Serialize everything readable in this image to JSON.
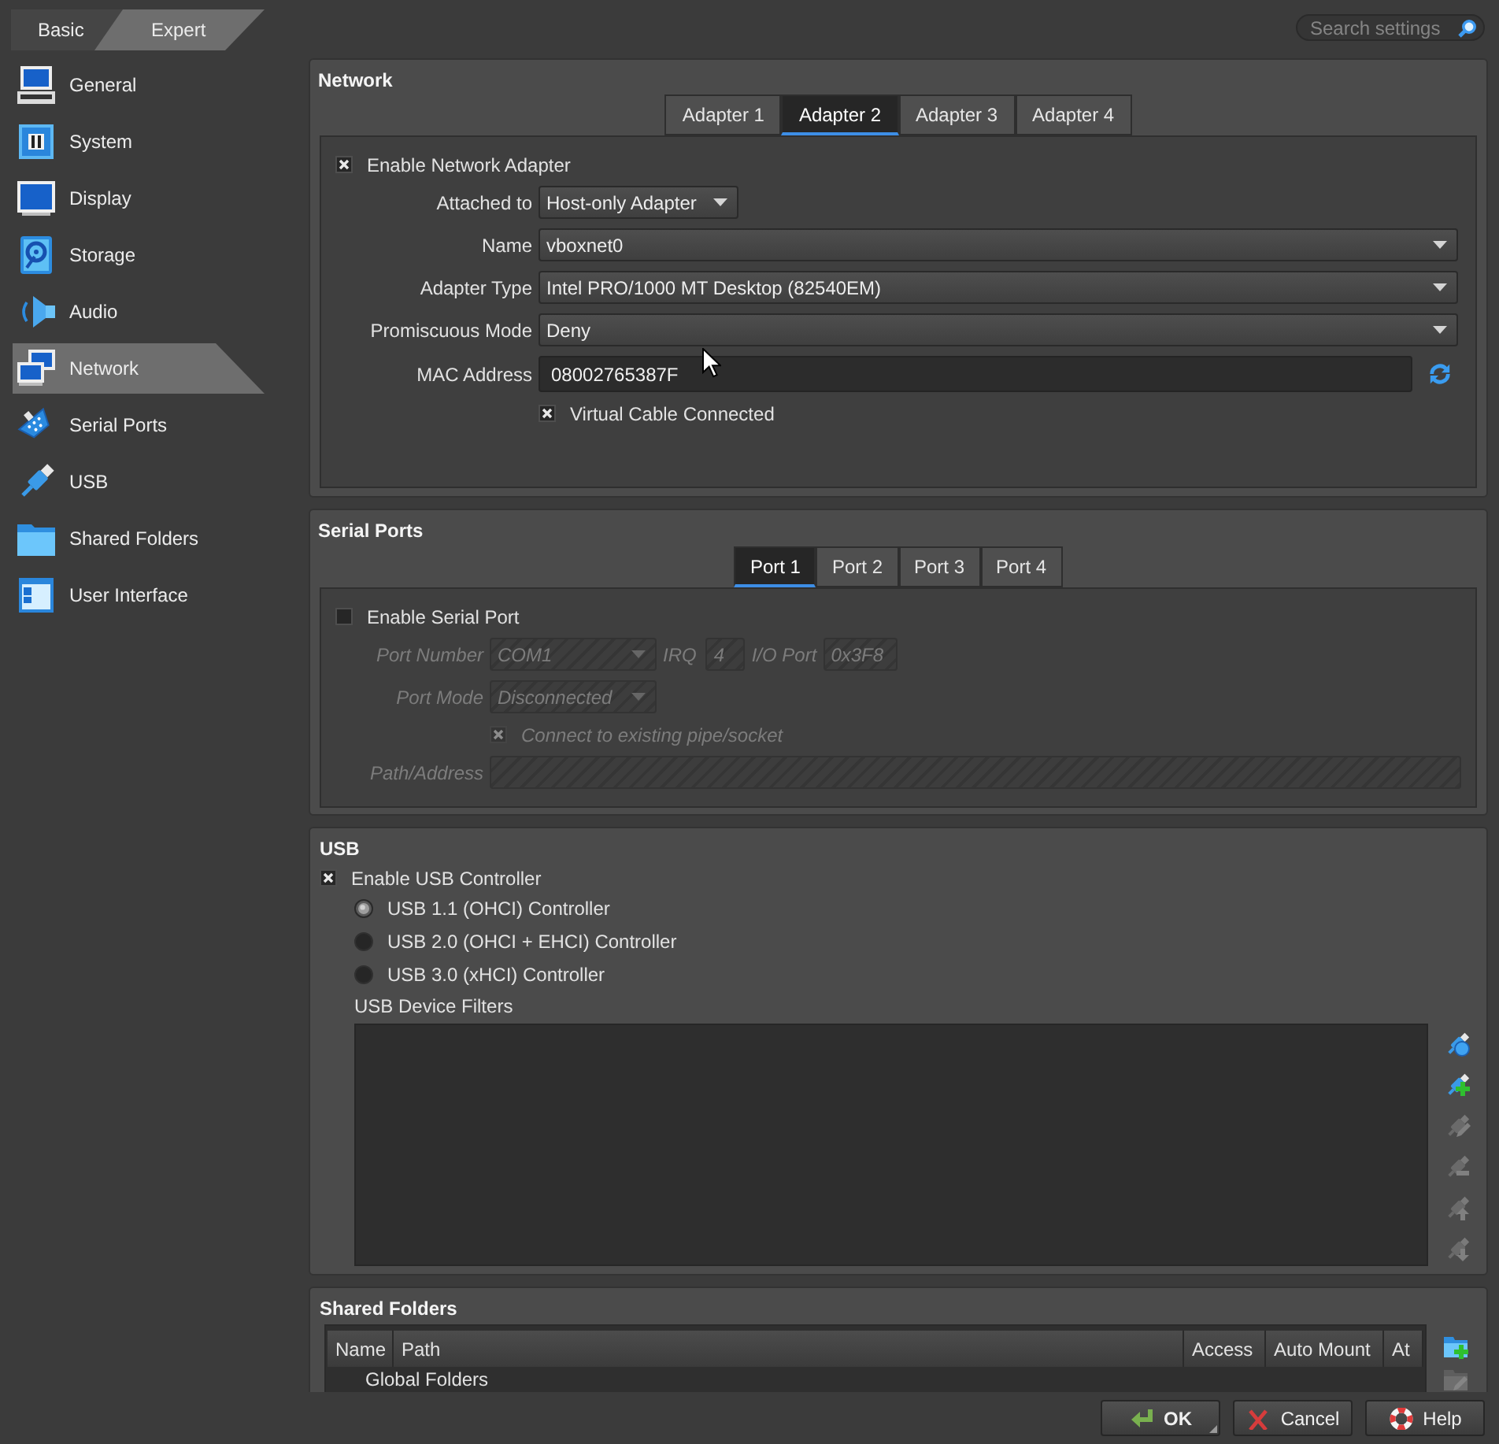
{
  "mode_toggle": [
    {
      "label": "Basic",
      "selected": false
    },
    {
      "label": "Expert",
      "selected": true
    }
  ],
  "search": {
    "placeholder": "Search settings"
  },
  "sidebar": {
    "items": [
      {
        "label": "General",
        "kind": "general",
        "selected": false
      },
      {
        "label": "System",
        "kind": "system",
        "selected": false
      },
      {
        "label": "Display",
        "kind": "display",
        "selected": false
      },
      {
        "label": "Storage",
        "kind": "storage",
        "selected": false
      },
      {
        "label": "Audio",
        "kind": "audio",
        "selected": false
      },
      {
        "label": "Network",
        "kind": "network",
        "selected": true
      },
      {
        "label": "Serial Ports",
        "kind": "serial",
        "selected": false
      },
      {
        "label": "USB",
        "kind": "usb",
        "selected": false
      },
      {
        "label": "Shared Folders",
        "kind": "folders",
        "selected": false
      },
      {
        "label": "User Interface",
        "kind": "interface",
        "selected": false
      }
    ]
  },
  "network": {
    "title": "Network",
    "tabs": [
      {
        "label": "Adapter 1",
        "selected": false
      },
      {
        "label": "Adapter 2",
        "selected": true
      },
      {
        "label": "Adapter 3",
        "selected": false
      },
      {
        "label": "Adapter 4",
        "selected": false
      }
    ],
    "enable": {
      "label": "Enable Network Adapter",
      "checked": true
    },
    "fields": [
      {
        "kind": "compact",
        "label": "Attached to",
        "value": "Host-only Adapter"
      },
      {
        "kind": "combo",
        "label": "Name",
        "value": "vboxnet0"
      },
      {
        "kind": "combo",
        "label": "Adapter Type",
        "value": "Intel PRO/1000 MT Desktop (82540EM)"
      },
      {
        "kind": "combo",
        "label": "Promiscuous Mode",
        "value": "Deny"
      },
      {
        "kind": "text",
        "label": "MAC Address",
        "value": "08002765387F"
      }
    ],
    "cable": {
      "label": "Virtual Cable Connected",
      "checked": true
    }
  },
  "serial_ports": {
    "title": "Serial Ports",
    "tabs": [
      {
        "label": "Port 1",
        "selected": true
      },
      {
        "label": "Port 2",
        "selected": false
      },
      {
        "label": "Port 3",
        "selected": false
      },
      {
        "label": "Port 4",
        "selected": false
      }
    ],
    "enable": {
      "label": "Enable Serial Port",
      "checked": false
    },
    "port_number": {
      "label": "Port Number",
      "value": "COM1"
    },
    "irq": {
      "label": "IRQ",
      "value": "4"
    },
    "io_port": {
      "label": "I/O Port",
      "value": "0x3F8"
    },
    "port_mode": {
      "label": "Port Mode",
      "value": "Disconnected"
    },
    "connect_existing": {
      "label": "Connect to existing pipe/socket",
      "checked": true
    },
    "path": {
      "label": "Path/Address"
    }
  },
  "usb": {
    "title": "USB",
    "enable": {
      "label": "Enable USB Controller",
      "checked": true
    },
    "controllers": [
      {
        "label": "USB 1.1 (OHCI) Controller",
        "selected": true
      },
      {
        "label": "USB 2.0 (OHCI + EHCI) Controller",
        "selected": false
      },
      {
        "label": "USB 3.0 (xHCI) Controller",
        "selected": false
      }
    ],
    "filters_label": "USB Device Filters",
    "tools": [
      {
        "kind": "new",
        "disabled": false
      },
      {
        "kind": "add",
        "disabled": false
      },
      {
        "kind": "edit",
        "disabled": true
      },
      {
        "kind": "remove",
        "disabled": true
      },
      {
        "kind": "up",
        "disabled": true
      },
      {
        "kind": "down",
        "disabled": true
      }
    ]
  },
  "shared_folders": {
    "title": "Shared Folders",
    "columns": [
      "Name",
      "Path",
      "Access",
      "Auto Mount",
      "At"
    ],
    "groups": [
      "Global Folders"
    ],
    "tools": [
      {
        "kind": "add",
        "disabled": false
      },
      {
        "kind": "edit",
        "disabled": true
      }
    ]
  },
  "buttons": [
    {
      "kind": "ok",
      "label": "OK",
      "default": true
    },
    {
      "kind": "cancel",
      "label": "Cancel",
      "default": false
    },
    {
      "kind": "help",
      "label": "Help",
      "default": false
    }
  ]
}
